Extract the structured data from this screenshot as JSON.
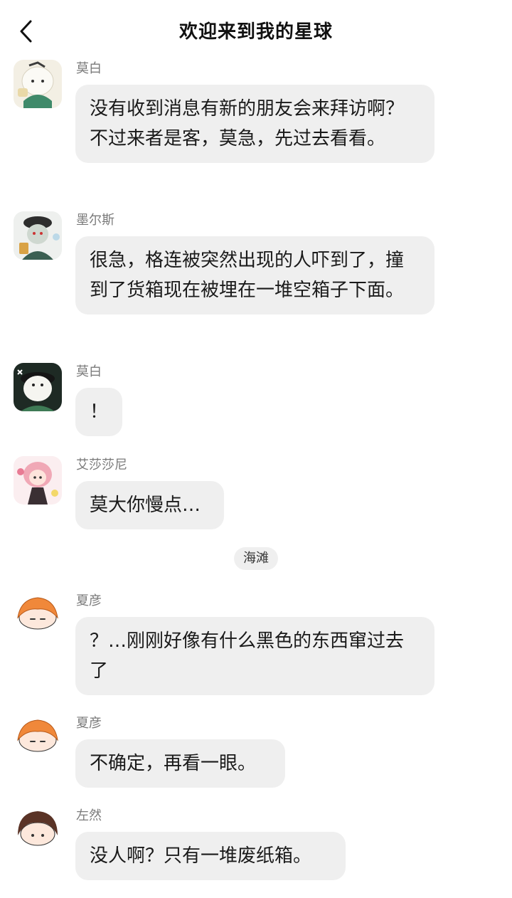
{
  "header": {
    "title": "欢迎来到我的星球",
    "back_icon": "chevron-left-icon"
  },
  "messages": [
    {
      "sender": "莫白",
      "text": "没有收到消息有新的朋友会来拜访啊？不过来者是客，莫急，先过去看看。",
      "avatar": "white-haired-character-avatar"
    },
    {
      "sender": "墨尔斯",
      "text": "很急，格连被突然出现的人吓到了，撞到了货箱现在被埋在一堆空箱子下面。",
      "avatar": "green-character-in-hat-avatar"
    },
    {
      "sender": "莫白",
      "text": "！",
      "avatar": "white-bearded-character-avatar"
    },
    {
      "sender": "艾莎莎尼",
      "text": "莫大你慢点…",
      "avatar": "pink-haired-character-avatar"
    },
    {
      "sender": "夏彦",
      "text": "？…刚刚好像有什么黑色的东西窜过去了",
      "avatar": "orange-haired-character-avatar"
    },
    {
      "sender": "夏彦",
      "text": "不确定，再看一眼。",
      "avatar": "orange-haired-character-avatar"
    },
    {
      "sender": "左然",
      "text": "没人啊？只有一堆废纸箱。",
      "avatar": "brown-haired-character-avatar"
    }
  ],
  "scene_divider": "海滩",
  "colors": {
    "bubble": "#efefef",
    "sender": "#7a7a7a",
    "text": "#1a1a1a"
  }
}
